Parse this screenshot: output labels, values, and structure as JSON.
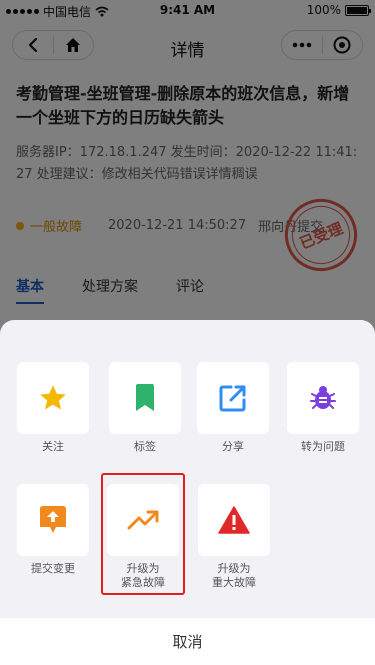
{
  "status_bar": {
    "carrier": "中国电信",
    "time": "9:41 AM",
    "battery": "100%"
  },
  "nav": {
    "title": "详情"
  },
  "ticket": {
    "title": "考勤管理-坐班管理-删除原本的班次信息，新增一个坐班下方的日历缺失箭头",
    "info": "服务器IP：172.18.1.247 发生时间：2020-12-22 11:41:27 处理建议：修改相关代码错误详情稠误",
    "tag": "一般故障",
    "datetime": "2020-12-21 14:50:27",
    "submitter": "邢向丹提交",
    "stamp": "已受理"
  },
  "tabs": [
    "基本",
    "处理方案",
    "评论"
  ],
  "sheet": {
    "actions": [
      {
        "label": "关注",
        "icon": "star-icon",
        "color": "#f5b800"
      },
      {
        "label": "标签",
        "icon": "bookmark-icon",
        "color": "#2db36b"
      },
      {
        "label": "分享",
        "icon": "share-icon",
        "color": "#2f8ef0"
      },
      {
        "label": "转为问题",
        "icon": "bug-icon",
        "color": "#7b3fe0"
      },
      {
        "label": "提交变更",
        "icon": "upload-icon",
        "color": "#f08a1c"
      },
      {
        "label": "升级为\n紧急故障",
        "icon": "trend-up-icon",
        "color": "#f08a1c"
      },
      {
        "label": "升级为\n重大故障",
        "icon": "warning-icon",
        "color": "#e02828"
      }
    ],
    "cancel": "取消"
  }
}
